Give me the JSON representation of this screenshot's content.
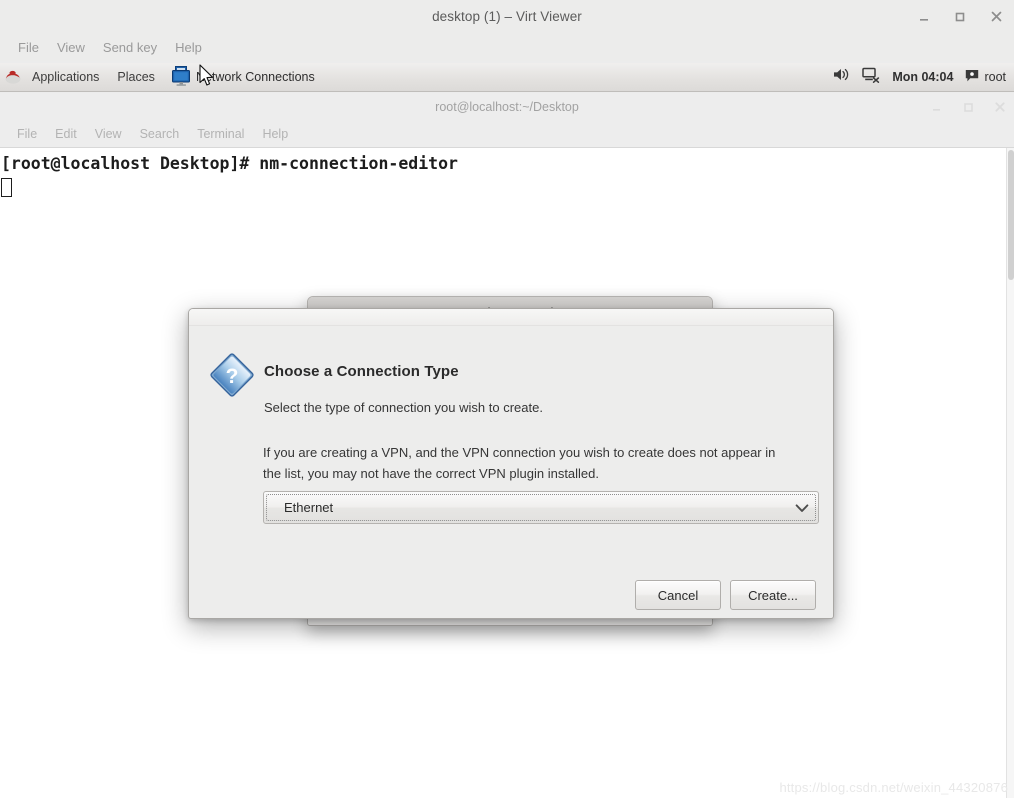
{
  "virt_viewer": {
    "title": "desktop (1) – Virt Viewer",
    "menu": [
      "File",
      "View",
      "Send key",
      "Help"
    ],
    "window_buttons": {
      "minimize": "minimize-icon",
      "maximize": "maximize-icon",
      "close": "close-icon"
    }
  },
  "gnome_panel": {
    "applications_label": "Applications",
    "places_label": "Places",
    "window_list_item": "Network Connections",
    "window_list_icon": "monitor-icon",
    "volume_icon": "volume-icon",
    "network_icon": "network-disconnected-icon",
    "clock": "Mon 04:04",
    "user": "root",
    "user_icon": "user-status-icon",
    "logo_icon": "red-hat-logo-icon"
  },
  "terminal": {
    "title": "root@localhost:~/Desktop",
    "menu": [
      "File",
      "Edit",
      "View",
      "Search",
      "Terminal",
      "Help"
    ],
    "prompt": "[root@localhost Desktop]# ",
    "command": "nm-connection-editor"
  },
  "network_connections_window": {
    "title": "Network Connections"
  },
  "dialog": {
    "heading": "Choose a Connection Type",
    "subtext": "Select the type of connection you wish to create.",
    "paragraph": "If you are creating a VPN, and the VPN connection you wish to create does not appear in the list, you may not have the correct VPN plugin installed.",
    "icon": "question-diamond-icon",
    "combo": {
      "value": "Ethernet",
      "arrow_icon": "chevron-down-icon"
    },
    "buttons": {
      "cancel": "Cancel",
      "create": "Create..."
    }
  },
  "watermark": {
    "text": "https://blog.csdn.net/weixin_44320876"
  },
  "colors": {
    "panel_bg": "#e4e2e0",
    "dialog_bg": "#ededec",
    "accent_blue": "#4a7fbd",
    "terminal_text": "#1d1d1d"
  }
}
